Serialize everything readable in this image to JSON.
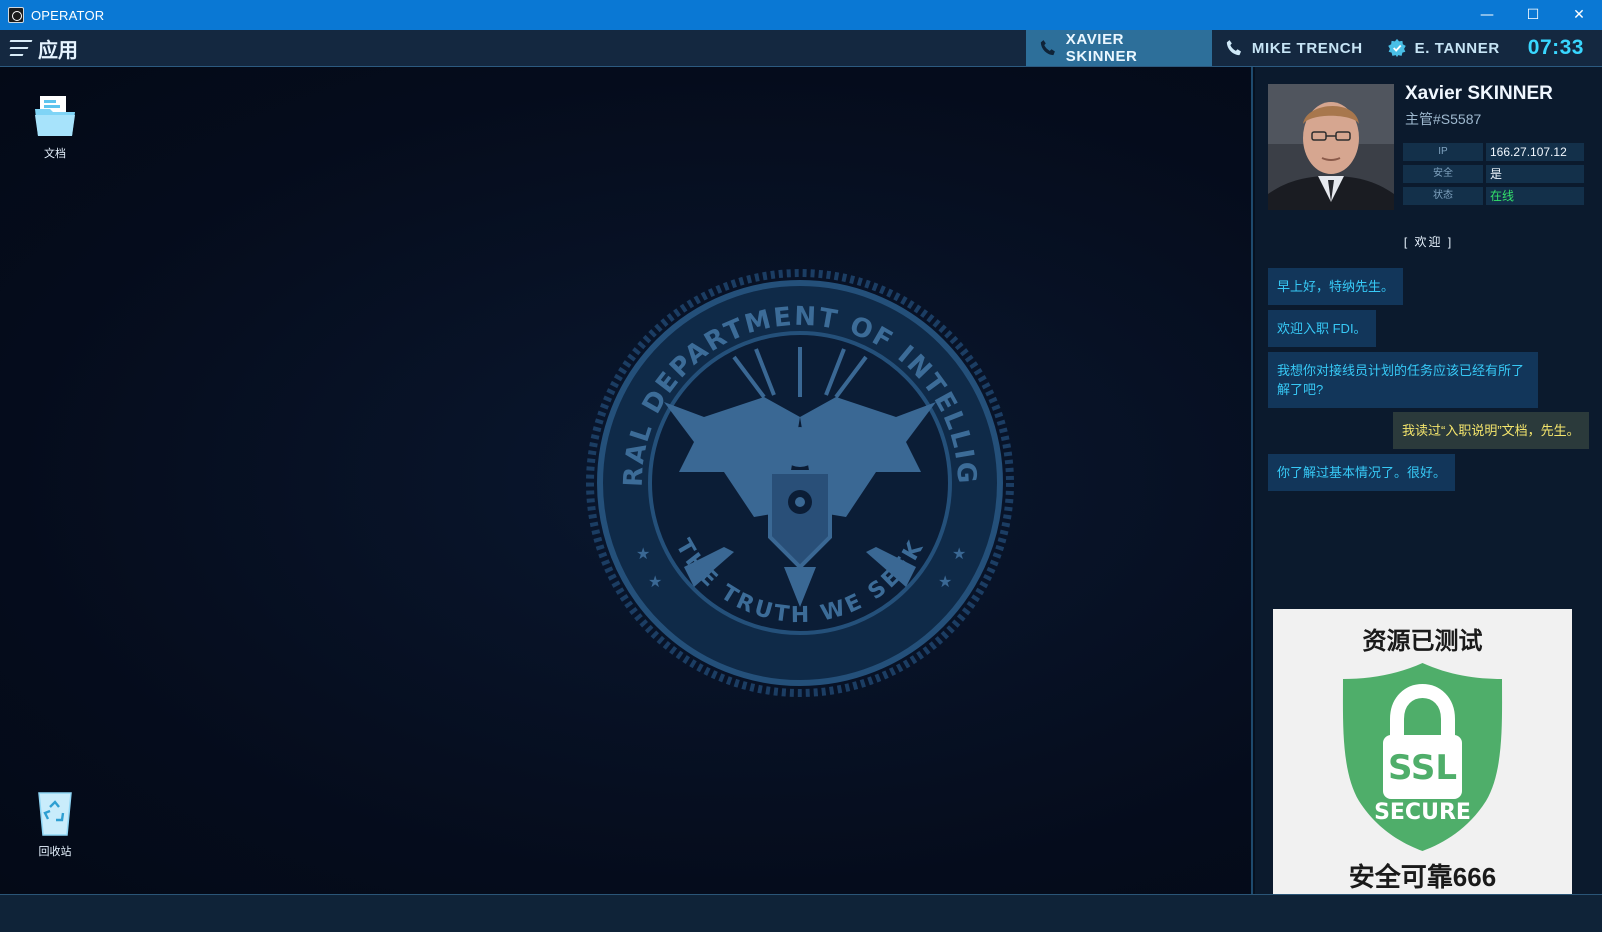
{
  "window": {
    "title": "OPERATOR",
    "controls": {
      "minimize": "—",
      "maximize": "☐",
      "close": "✕"
    }
  },
  "appbar": {
    "menu_label": "应用",
    "contacts": [
      {
        "name": "XAVIER SKINNER",
        "icon": "phone-icon",
        "active": true
      },
      {
        "name": "MIKE TRENCH",
        "icon": "phone-icon",
        "active": false
      },
      {
        "name": "E. TANNER",
        "icon": "badge-icon",
        "active": false
      }
    ],
    "clock": "07:33"
  },
  "desktop": {
    "icons": [
      {
        "label": "文档",
        "icon": "folder-icon"
      },
      {
        "label": "回收站",
        "icon": "recycle-bin-icon"
      }
    ],
    "seal": {
      "top_text": "FEDERAL DEPARTMENT OF INTELLIGENCE",
      "bottom_text": "THE TRUTH WE SEEK"
    }
  },
  "profile": {
    "name": "Xavier SKINNER",
    "role": "主管#S5587",
    "fields": [
      {
        "key": "IP",
        "value": "166.27.107.12"
      },
      {
        "key": "安全",
        "value": "是"
      },
      {
        "key": "状态",
        "value": "在线"
      }
    ],
    "status_color": "#33e06a"
  },
  "chat": {
    "header": "[ 欢迎 ]",
    "messages": [
      {
        "from": "contact",
        "text": "早上好，特纳先生。"
      },
      {
        "from": "contact",
        "text": "欢迎入职 FDI。"
      },
      {
        "from": "contact",
        "text": "我想你对接线员计划的任务应该已经有所了解了吧?"
      },
      {
        "from": "me",
        "text": "我读过“入职说明”文档，先生。"
      },
      {
        "from": "contact",
        "text": "你了解过基本情况了。很好。"
      }
    ]
  },
  "ssl_badge": {
    "top": "资源已测试",
    "ssl": "SSL",
    "secure": "SECURE",
    "bottom": "安全可靠666",
    "shield_color": "#4fae6a"
  },
  "colors": {
    "titlebar": "#0a78d4",
    "accent": "#39d7ff",
    "active_tab": "#2d6f9a"
  }
}
